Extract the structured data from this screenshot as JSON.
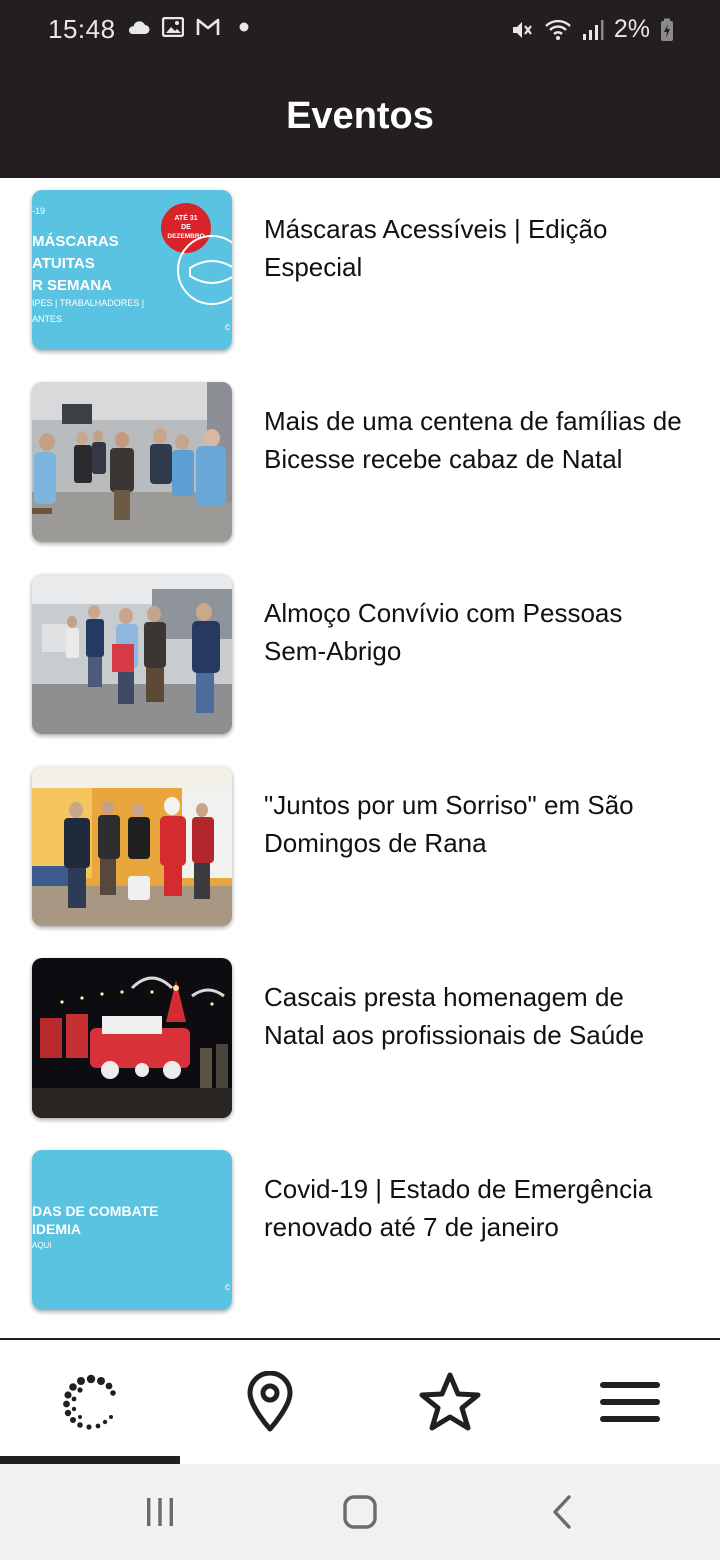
{
  "status_bar": {
    "time": "15:48",
    "left_icons": [
      "cloud-icon",
      "image-icon",
      "gmail-icon",
      "dot-icon"
    ],
    "right_icons": [
      "mute-icon",
      "wifi-icon",
      "signal-icon",
      "battery-icon"
    ],
    "battery": "2%"
  },
  "app_bar": {
    "title": "Eventos"
  },
  "events": [
    {
      "title": "Máscaras Acessíveis | Edição Especial",
      "thumb_text": {
        "line0": "-19",
        "line1": "MÁSCARAS",
        "line2": "ATUITAS",
        "line3": "R SEMANA",
        "line4": "IPES | TRABALHADORES |",
        "line5": "ANTES",
        "badge1": "ATÉ 31",
        "badge2": "DE",
        "badge3": "DEZEMBRO"
      }
    },
    {
      "title": "Mais de uma centena de famílias de Bicesse recebe cabaz de Natal"
    },
    {
      "title": "Almoço Convívio com Pessoas Sem-Abrigo"
    },
    {
      "title": "\"Juntos por um Sorriso\" em São Domingos de Rana"
    },
    {
      "title": "Cascais presta homenagem de Natal aos profissionais de Saúde"
    },
    {
      "title": "Covid-19 | Estado de Emergência renovado até 7 de janeiro",
      "thumb_text": {
        "line1": "DAS DE COMBATE",
        "line2": "IDEMIA",
        "line3": "AQUI"
      }
    }
  ],
  "bottom_nav": {
    "items": [
      {
        "icon": "cascais-logo-icon",
        "active": true
      },
      {
        "icon": "location-pin-icon",
        "active": false
      },
      {
        "icon": "star-icon",
        "active": false
      },
      {
        "icon": "menu-icon",
        "active": false
      }
    ]
  },
  "colors": {
    "dark": "#231f20",
    "thumb_blue": "#5bc3e2",
    "badge_red": "#d7232a"
  }
}
